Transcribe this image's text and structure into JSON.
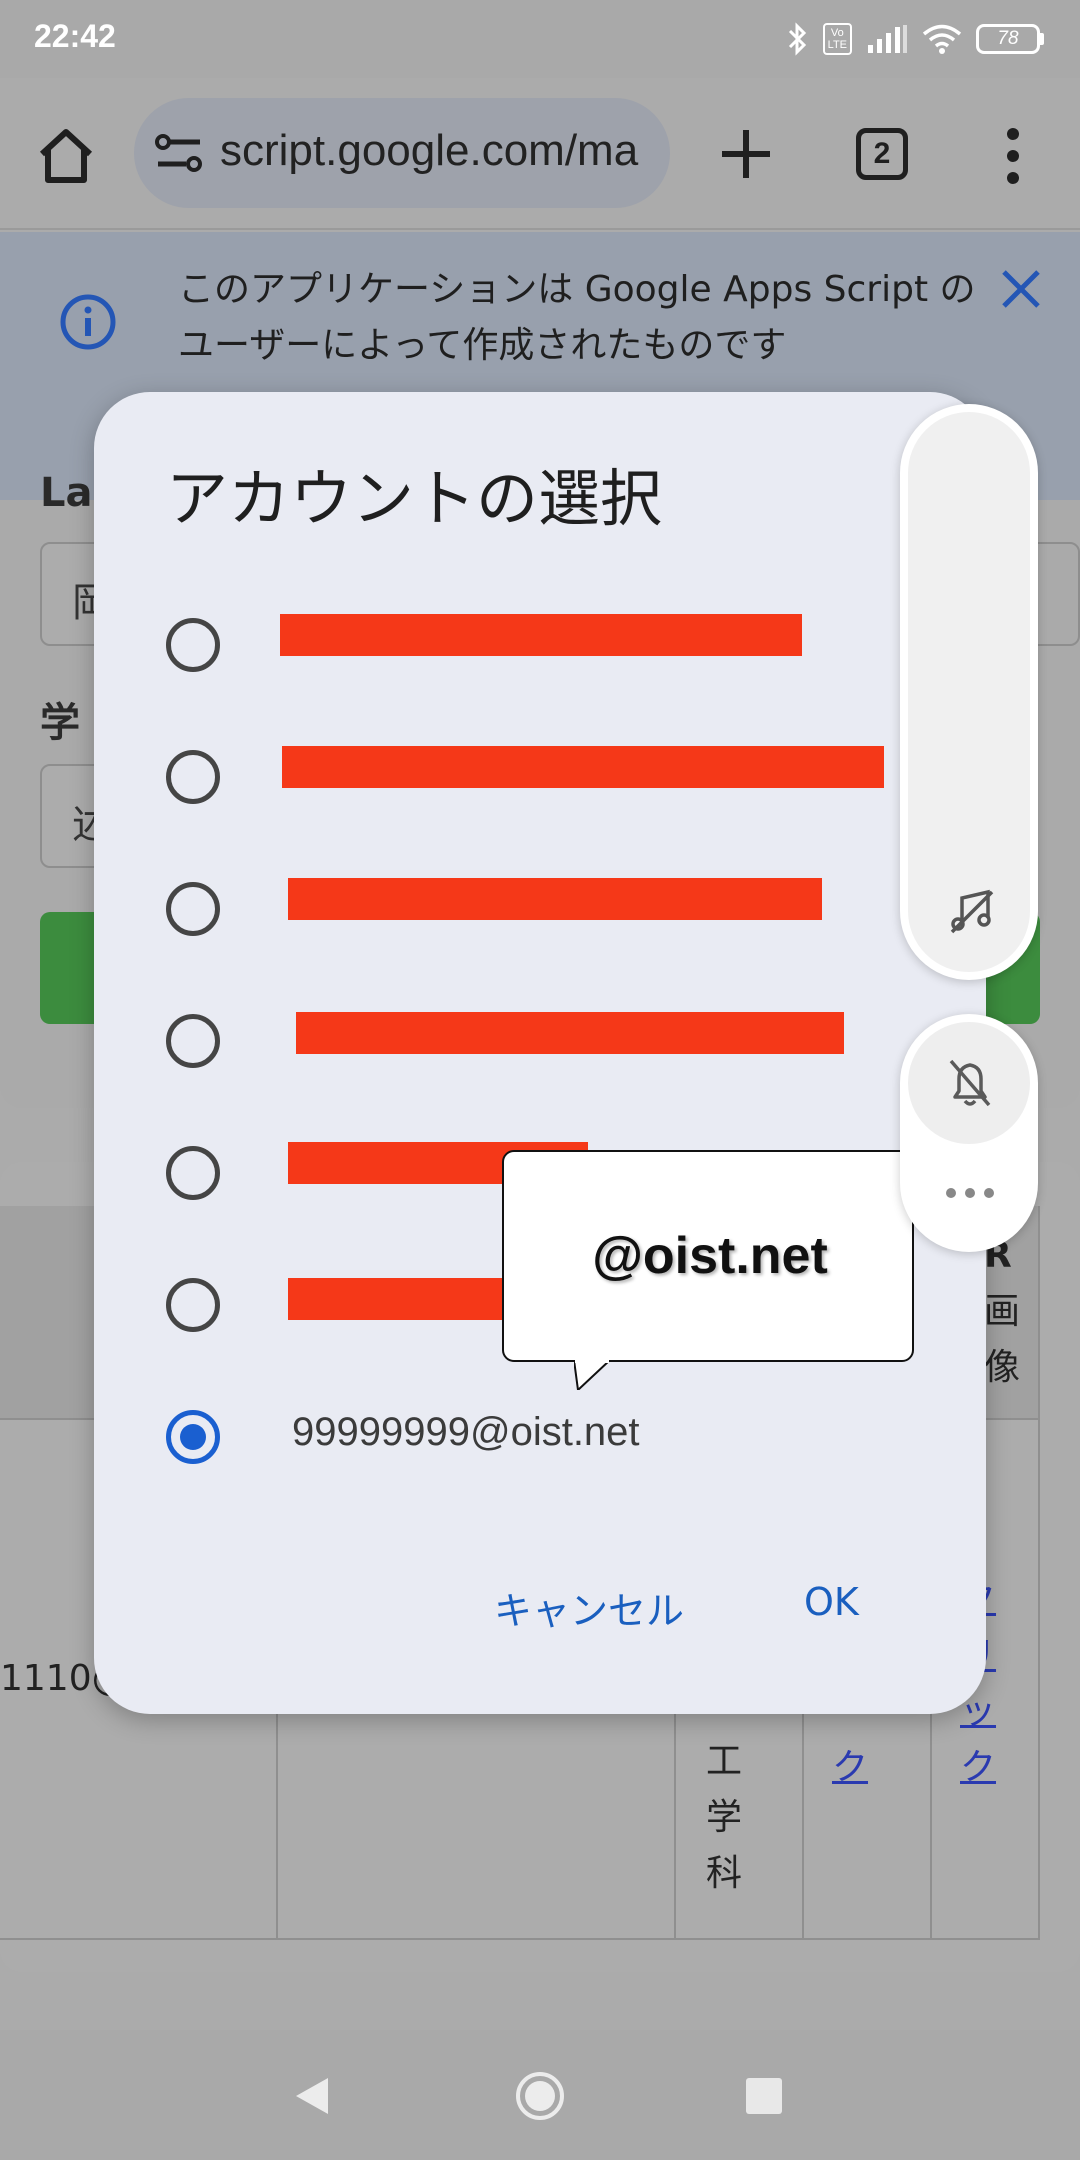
{
  "status_bar": {
    "time": "22:42",
    "battery": "78",
    "volte": "Vo\nLTE"
  },
  "browser": {
    "url": "script.google.com/ma",
    "tab_count": "2"
  },
  "banner": {
    "text": "このアプリケーションは Google Apps Script のユーザーによって作成されたものです"
  },
  "background": {
    "field_char": "岡",
    "field2_char": "述",
    "label1": "La",
    "label2": "学",
    "row_email_fragment": "1110@",
    "header_right": [
      "R",
      "画",
      "像"
    ],
    "vertical_text": [
      "工",
      "学",
      "科"
    ],
    "link1": [
      "ク"
    ],
    "link2": [
      "ク",
      "リ",
      "ッ",
      "ク"
    ]
  },
  "dialog": {
    "title": "アカウントの選択",
    "accounts": [
      {
        "label": "",
        "redacted": true,
        "selected": false
      },
      {
        "label": "",
        "redacted": true,
        "selected": false
      },
      {
        "label": "",
        "redacted": true,
        "selected": false
      },
      {
        "label": "",
        "redacted": true,
        "selected": false
      },
      {
        "label": "",
        "redacted": true,
        "selected": false
      },
      {
        "label": "",
        "redacted": true,
        "selected": false
      },
      {
        "label": "99999999@oist.net",
        "redacted": false,
        "selected": true
      }
    ],
    "cancel_label": "キャンセル",
    "ok_label": "OK"
  },
  "callout": {
    "text": "@oist.net"
  },
  "colors": {
    "accent": "#1a5fd0",
    "redaction": "#f53818",
    "dialog_bg": "#e9ebf3",
    "button_text": "#1a5fbf"
  },
  "icons": [
    "home-icon",
    "tune-icon",
    "plus-icon",
    "tabs-icon",
    "more-vert-icon",
    "info-icon",
    "close-icon",
    "bluetooth-icon",
    "signal-icon",
    "wifi-icon",
    "battery-icon",
    "music-off-icon",
    "bell-off-icon",
    "more-horiz-icon",
    "back-icon",
    "home-circle-icon",
    "recents-icon"
  ]
}
